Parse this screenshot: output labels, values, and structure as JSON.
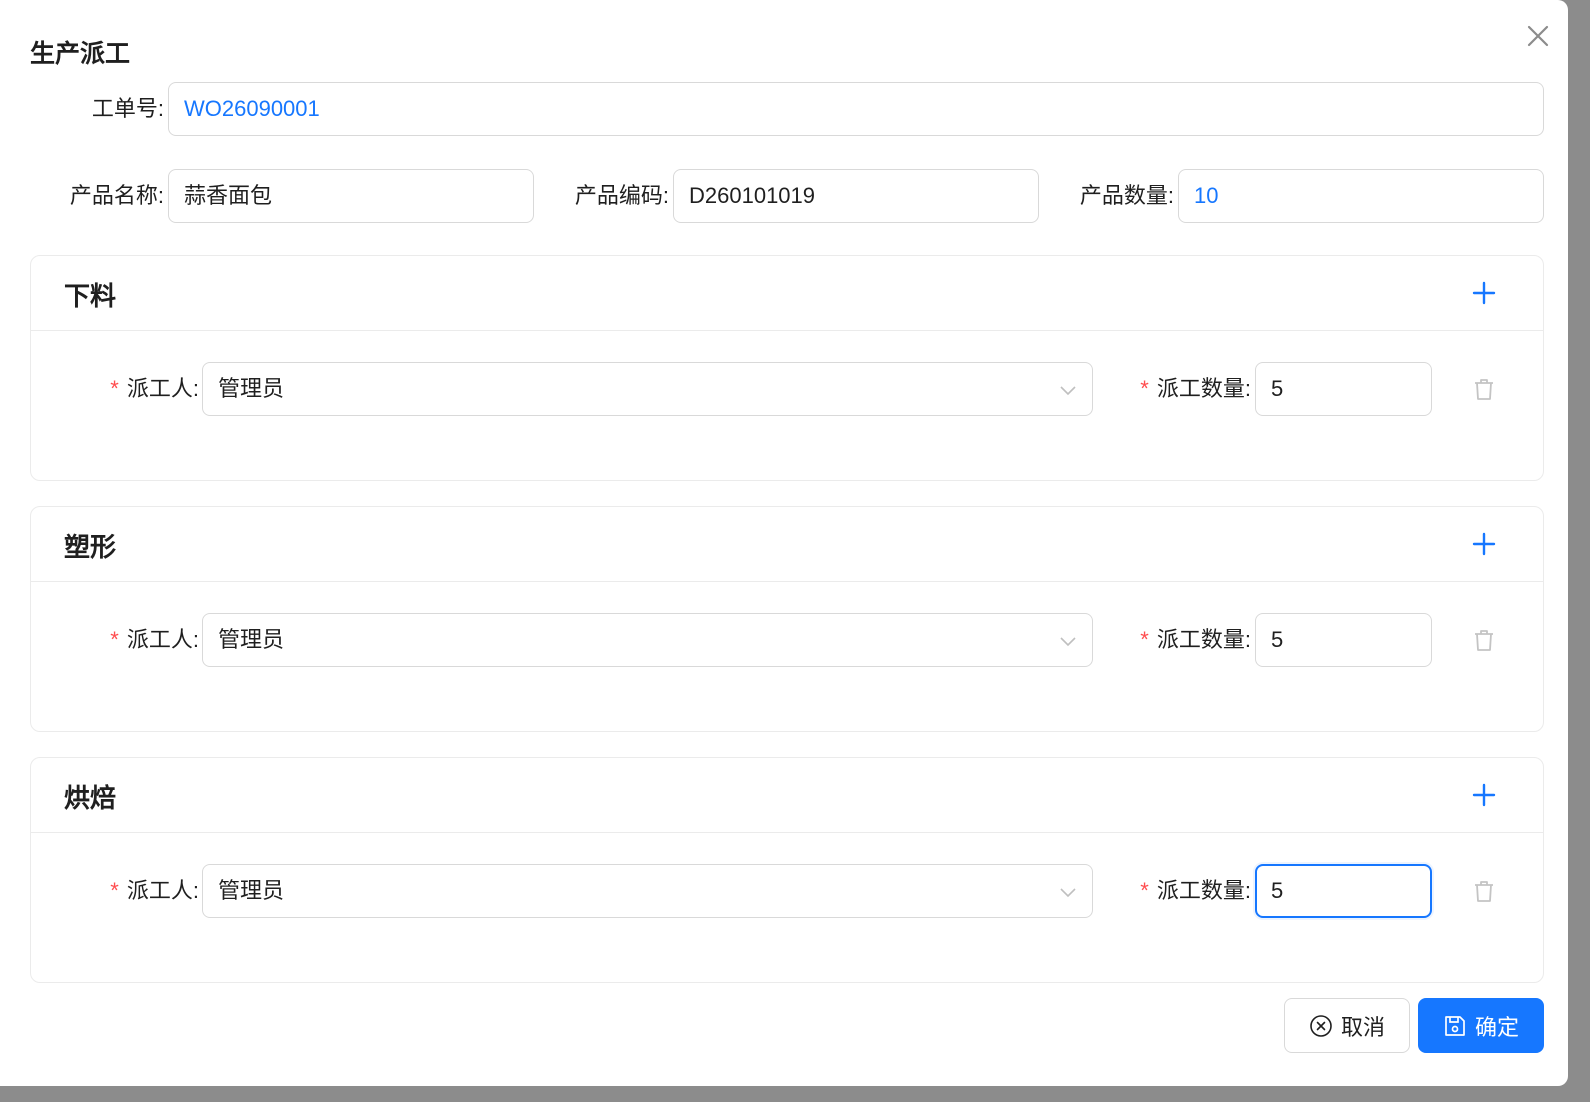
{
  "dialog": {
    "title": "生产派工",
    "close_icon": "close-icon"
  },
  "work_order": {
    "label": "工单号",
    "value": "WO26090001"
  },
  "product": {
    "name_label": "产品名称",
    "name_value": "蒜香面包",
    "code_label": "产品编码",
    "code_value": "D260101019",
    "qty_label": "产品数量",
    "qty_value": "10"
  },
  "colon": ":",
  "required_mark": "*",
  "sections": [
    {
      "title": "下料",
      "worker_label": "派工人",
      "worker_value": "管理员",
      "qty_label": "派工数量",
      "qty_value": "5"
    },
    {
      "title": "塑形",
      "worker_label": "派工人",
      "worker_value": "管理员",
      "qty_label": "派工数量",
      "qty_value": "5"
    },
    {
      "title": "烘焙",
      "worker_label": "派工人",
      "worker_value": "管理员",
      "qty_label": "派工数量",
      "qty_value": "5"
    }
  ],
  "footer": {
    "cancel_label": "取消",
    "ok_label": "确定"
  },
  "colors": {
    "accent": "#1677ff",
    "required": "#ff4d4f"
  }
}
